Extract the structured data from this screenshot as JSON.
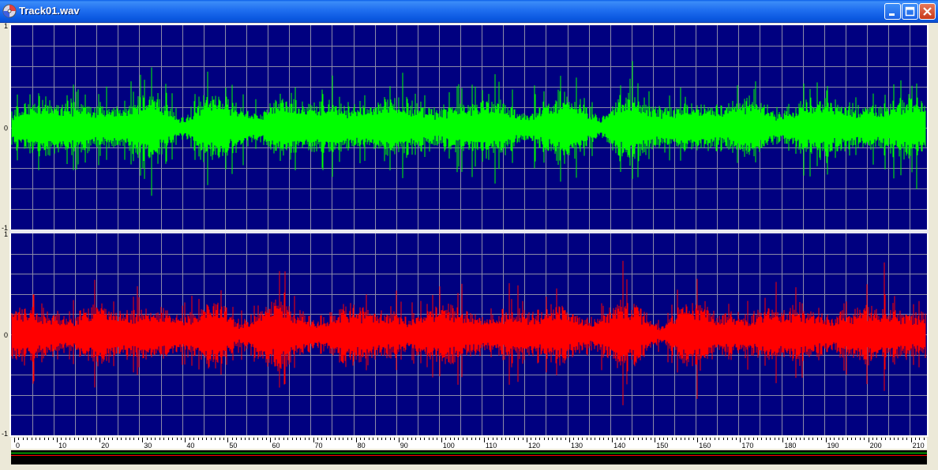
{
  "window": {
    "title": "Track01.wav"
  },
  "icons": {
    "app": "disc-icon",
    "minimize": "minimize-icon",
    "maximize": "maximize-icon",
    "close": "close-icon"
  },
  "colors": {
    "plot_background": "#000080",
    "grid": "#8a8aa8",
    "left_channel": "#00ff00",
    "right_channel": "#ff0000",
    "divider": "#e8e8f0",
    "ruler": "#ffffff"
  },
  "chart_data": [
    {
      "type": "line",
      "series": [
        {
          "color": "#00ff00"
        }
      ],
      "ylim": [
        -1,
        1
      ],
      "xlim": [
        0,
        213
      ],
      "y_ticks": [
        "1",
        "0",
        "-1"
      ],
      "grid": true
    },
    {
      "type": "line",
      "series": [
        {
          "color": "#ff0000"
        }
      ],
      "ylim": [
        -1,
        1
      ],
      "xlim": [
        0,
        213
      ],
      "y_ticks": [
        "1",
        "0",
        "-1"
      ],
      "grid": true
    }
  ],
  "ruler": {
    "ticks": [
      "0",
      "10",
      "20",
      "30",
      "40",
      "50",
      "60",
      "70",
      "80",
      "90",
      "100",
      "110",
      "120",
      "130",
      "140",
      "150",
      "160",
      "170",
      "180",
      "190",
      "200",
      "210"
    ]
  }
}
